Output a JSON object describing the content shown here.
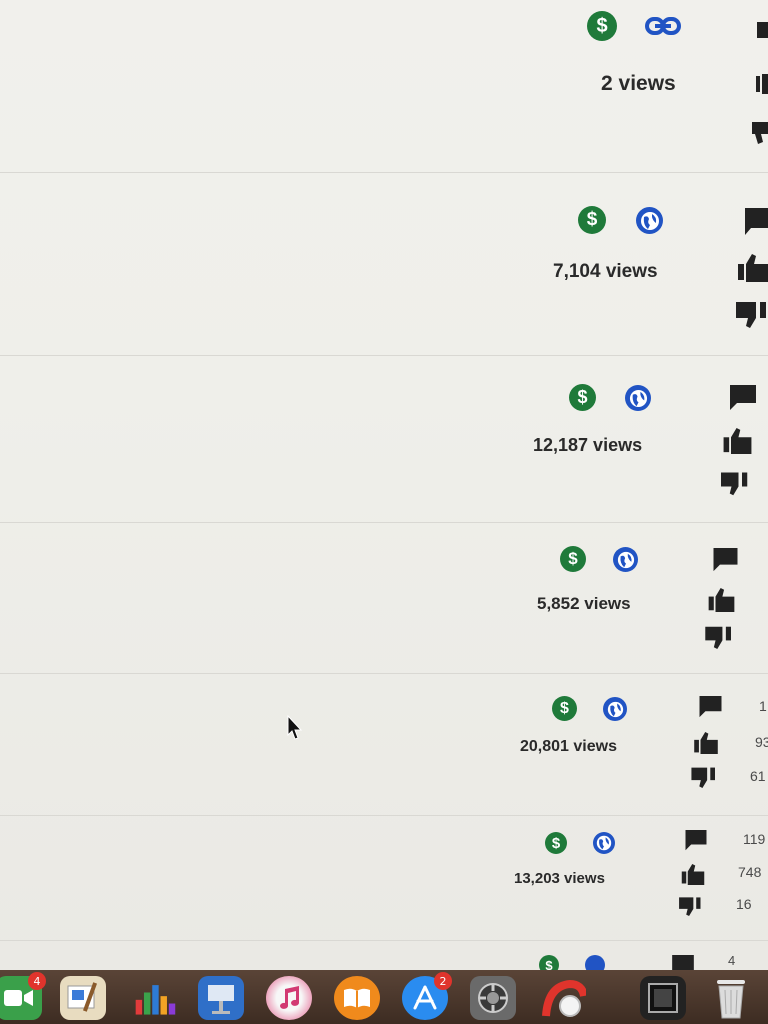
{
  "video_rows": [
    {
      "views": "2 views",
      "visibility_icon": "link-icon",
      "counts": {
        "comments": "",
        "likes": "",
        "dislikes": ""
      }
    },
    {
      "views": "7,104 views",
      "visibility_icon": "globe-icon",
      "counts": {
        "comments": "",
        "likes": "",
        "dislikes": ""
      }
    },
    {
      "views": "12,187 views",
      "visibility_icon": "globe-icon",
      "counts": {
        "comments": "",
        "likes": "",
        "dislikes": ""
      }
    },
    {
      "views": "5,852 views",
      "visibility_icon": "globe-icon",
      "counts": {
        "comments": "",
        "likes": "",
        "dislikes": ""
      }
    },
    {
      "views": "20,801 views",
      "visibility_icon": "globe-icon",
      "counts": {
        "comments": "1",
        "likes": "93",
        "dislikes": "61"
      }
    },
    {
      "views": "13,203 views",
      "visibility_icon": "globe-icon",
      "counts": {
        "comments": "119",
        "likes": "748",
        "dislikes": "16"
      }
    },
    {
      "views": "",
      "visibility_icon": "globe-icon",
      "counts": {
        "comments": "4",
        "likes": "",
        "dislikes": ""
      }
    }
  ],
  "colors": {
    "monetization_green": "#1f7a3a",
    "public_blue": "#2154c4",
    "badge_red": "#e0342c"
  },
  "dock": {
    "apps": [
      {
        "name": "facetime-icon",
        "badge": "4"
      },
      {
        "name": "preview-icon",
        "badge": ""
      },
      {
        "name": "numbers-icon",
        "badge": ""
      },
      {
        "name": "keynote-icon",
        "badge": ""
      },
      {
        "name": "itunes-icon",
        "badge": ""
      },
      {
        "name": "ibooks-icon",
        "badge": ""
      },
      {
        "name": "app-store-icon",
        "badge": "2"
      },
      {
        "name": "system-preferences-icon",
        "badge": ""
      },
      {
        "name": "screen-recorder-icon",
        "badge": ""
      },
      {
        "name": "photo-booth-icon",
        "badge": ""
      },
      {
        "name": "trash-icon",
        "badge": ""
      }
    ]
  }
}
